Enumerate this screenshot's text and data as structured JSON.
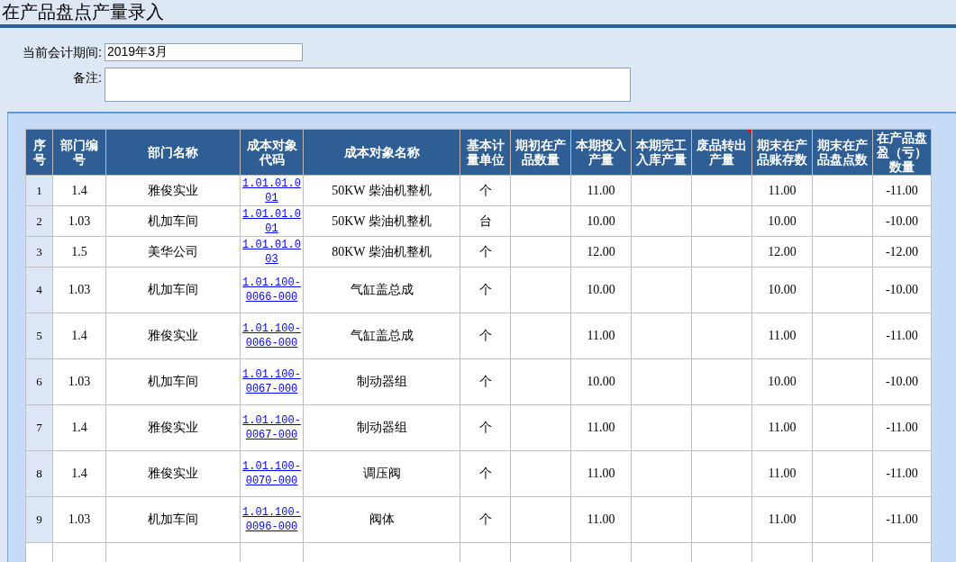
{
  "page": {
    "title": "在产品盘点产量录入"
  },
  "form": {
    "fields": [
      {
        "kind": "text",
        "label": "当前会计期间:",
        "value": "2019年3月"
      },
      {
        "kind": "memo",
        "label": "备注:"
      }
    ]
  },
  "table": {
    "columns": [
      {
        "label": "序号",
        "corner_mark": false
      },
      {
        "label": "部门编号",
        "corner_mark": false
      },
      {
        "label": "部门名称",
        "corner_mark": false
      },
      {
        "label": "成本对象代码",
        "corner_mark": false
      },
      {
        "label": "成本对象名称",
        "corner_mark": false
      },
      {
        "label": "基本计量单位",
        "corner_mark": false
      },
      {
        "label": "期初在产品数量",
        "corner_mark": false
      },
      {
        "label": "本期投入产量",
        "corner_mark": false
      },
      {
        "label": "本期完工入库产量",
        "corner_mark": false
      },
      {
        "label": "废品转出产量",
        "corner_mark": true
      },
      {
        "label": "期末在产品账存数",
        "corner_mark": false
      },
      {
        "label": "期末在产品盘点数",
        "corner_mark": false
      },
      {
        "label": "在产品盘盈（亏）数量",
        "corner_mark": false
      }
    ],
    "rows": [
      {
        "seq": "1",
        "dept_code": "1.4",
        "dept_name": "雅俊实业",
        "object_code": "1.01.01.001",
        "object_name": "50KW 柴油机整机",
        "unit": "个",
        "input_qty": "11.00",
        "book_qty": "11.00",
        "variance_qty": "-11.00"
      },
      {
        "seq": "2",
        "dept_code": "1.03",
        "dept_name": "机加车间",
        "object_code": "1.01.01.001",
        "object_name": "50KW 柴油机整机",
        "unit": "台",
        "input_qty": "10.00",
        "book_qty": "10.00",
        "variance_qty": "-10.00"
      },
      {
        "seq": "3",
        "dept_code": "1.5",
        "dept_name": "美华公司",
        "object_code": "1.01.01.003",
        "object_name": "80KW 柴油机整机",
        "unit": "个",
        "input_qty": "12.00",
        "book_qty": "12.00",
        "variance_qty": "-12.00"
      },
      {
        "seq": "4",
        "dept_code": "1.03",
        "dept_name": "机加车间",
        "object_code": "1.01.100-0066-000",
        "object_name": "气缸盖总成",
        "unit": "个",
        "input_qty": "10.00",
        "book_qty": "10.00",
        "variance_qty": "-10.00"
      },
      {
        "seq": "5",
        "dept_code": "1.4",
        "dept_name": "雅俊实业",
        "object_code": "1.01.100-0066-000",
        "object_name": "气缸盖总成",
        "unit": "个",
        "input_qty": "11.00",
        "book_qty": "11.00",
        "variance_qty": "-11.00"
      },
      {
        "seq": "6",
        "dept_code": "1.03",
        "dept_name": "机加车间",
        "object_code": "1.01.100-0067-000",
        "object_name": "制动器组",
        "unit": "个",
        "input_qty": "10.00",
        "book_qty": "10.00",
        "variance_qty": "-10.00"
      },
      {
        "seq": "7",
        "dept_code": "1.4",
        "dept_name": "雅俊实业",
        "object_code": "1.01.100-0067-000",
        "object_name": "制动器组",
        "unit": "个",
        "input_qty": "11.00",
        "book_qty": "11.00",
        "variance_qty": "-11.00"
      },
      {
        "seq": "8",
        "dept_code": "1.4",
        "dept_name": "雅俊实业",
        "object_code": "1.01.100-0070-000",
        "object_name": "调压阀",
        "unit": "个",
        "input_qty": "11.00",
        "book_qty": "11.00",
        "variance_qty": "-11.00"
      },
      {
        "seq": "9",
        "dept_code": "1.03",
        "dept_name": "机加车间",
        "object_code": "1.01.100-0096-000",
        "object_name": "阀体",
        "unit": "个",
        "input_qty": "11.00",
        "book_qty": "11.00",
        "variance_qty": "-11.00"
      }
    ]
  }
}
